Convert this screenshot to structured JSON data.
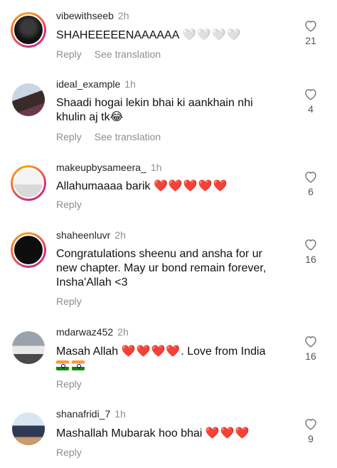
{
  "comments": [
    {
      "username": "vibewithseeb",
      "time": "2h",
      "text": "SHAHEEEEENAAAAAA",
      "emoji": "🤍🤍🤍🤍",
      "actions": [
        "Reply",
        "See translation"
      ],
      "likes": "21"
    },
    {
      "username": "ideal_example",
      "time": "1h",
      "text": "Shaadi hogai lekin bhai ki aankhain nhi khulin aj tk😂",
      "emoji": "",
      "actions": [
        "Reply",
        "See translation"
      ],
      "likes": "4"
    },
    {
      "username": "makeupbysameera_",
      "time": "1h",
      "text": "Allahumaaaa barik",
      "emoji": "❤️❤️❤️❤️❤️",
      "actions": [
        "Reply"
      ],
      "likes": "6"
    },
    {
      "username": "shaheenluvr",
      "time": "2h",
      "text": "Congratulations sheenu and ansha for ur new chapter. May ur bond remain forever, Insha'Allah <3",
      "emoji": "",
      "actions": [
        "Reply"
      ],
      "likes": "16"
    },
    {
      "username": "mdarwaz452",
      "time": "2h",
      "text_before": "Masah Allah",
      "emoji": "❤️❤️❤️❤️",
      "text_after": ". Love from India",
      "flags": "🇮🇳🇮🇳",
      "actions": [
        "Reply"
      ],
      "likes": "16"
    },
    {
      "username": "shanafridi_7",
      "time": "1h",
      "text": "Mashallah Mubarak hoo bhai",
      "emoji": "❤️❤️❤️",
      "actions": [
        "Reply"
      ],
      "likes": "9"
    }
  ],
  "colors": {
    "heart_red": "#e0202f",
    "muted_text": "#8e8e8e",
    "story_ring": "#e1306c"
  },
  "icons": {
    "like": "heart-outline-icon"
  }
}
